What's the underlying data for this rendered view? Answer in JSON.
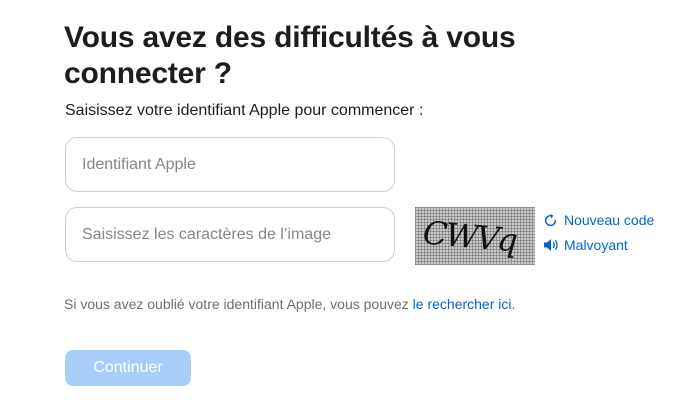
{
  "heading": {
    "title": "Vous avez des difficultés à vous connecter ?",
    "subtitle": "Saisissez votre identifiant Apple pour commencer :"
  },
  "form": {
    "apple_id_placeholder": "Identifiant Apple",
    "apple_id_value": "",
    "captcha_placeholder": "Saisissez les caractères de l’image",
    "captcha_value": "",
    "captcha_image_text": "CWVq"
  },
  "captcha_actions": {
    "new_code": {
      "label": "Nouveau code",
      "icon": "refresh-icon"
    },
    "audio": {
      "label": "Malvoyant",
      "icon": "speaker-icon"
    }
  },
  "help": {
    "prefix": "Si vous avez oublié votre identifiant Apple, vous pouvez ",
    "link": "le rechercher ici",
    "suffix": "."
  },
  "continue_button": {
    "label": "Continuer",
    "state": "disabled"
  },
  "colors": {
    "link": "#0066cc",
    "button_disabled": "#a8cdf6",
    "text_primary": "#1d1d1f",
    "text_secondary": "#6e6e73",
    "border": "#cfcfd4"
  }
}
